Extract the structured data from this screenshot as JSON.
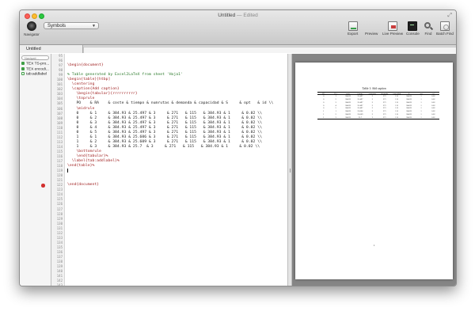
{
  "window": {
    "title": "Untitled",
    "title_suffix": " — Edited"
  },
  "toolbar": {
    "navigator_label": "Navigator",
    "symbols_value": "Symbols",
    "tools": [
      {
        "label": "Export",
        "icon": "export-icon"
      },
      {
        "label": "Preview",
        "icon": "preview-icon"
      },
      {
        "label": "Live Preview",
        "icon": "live-preview-icon"
      },
      {
        "label": "Console",
        "icon": "console-icon"
      },
      {
        "label": "Find",
        "icon": "find-icon"
      },
      {
        "label": "Batch Find",
        "icon": "batch-find-icon"
      }
    ]
  },
  "tabs": [
    {
      "label": "Untitled"
    }
  ],
  "sidebar": {
    "search_placeholder": "Navigati...",
    "items": [
      {
        "label": "TEX TS-pro..."
      },
      {
        "label": "TEX encodi..."
      },
      {
        "label": "tab:addlabel"
      }
    ]
  },
  "editor": {
    "lines": [
      {
        "n": "95",
        "text": "",
        "kind": ""
      },
      {
        "n": "96",
        "text": "",
        "kind": ""
      },
      {
        "n": "97",
        "text": "\\begin{document}",
        "kind": "cmd"
      },
      {
        "n": "98",
        "text": "",
        "kind": ""
      },
      {
        "n": "99",
        "text": "% Table generated by Excel2LaTeX from sheet 'Hoja1'",
        "kind": "comment"
      },
      {
        "n": "100",
        "text": "\\begin{table}[htbp]",
        "kind": "cmd"
      },
      {
        "n": "101",
        "text": "  \\centering",
        "kind": "cmd"
      },
      {
        "n": "102",
        "text": "  \\caption{Add caption}",
        "kind": "cmd"
      },
      {
        "n": "103",
        "text": "    \\begin{tabular}{rrrrrrrrrr}",
        "kind": "cmd"
      },
      {
        "n": "104",
        "text": "    \\toprule",
        "kind": "cmd"
      },
      {
        "n": "105",
        "text": "    PO    & RA    & coste & tiempo & numrutas & demanda & capacidad & S     & opt   & id \\\\",
        "kind": ""
      },
      {
        "n": "106",
        "text": "    \\midrule",
        "kind": "cmd"
      },
      {
        "n": "107",
        "text": "    0     & 1     & 384.93 & 25.497 & 3     & 271   & 115   & 384.93 & 1     & 0.02 \\\\",
        "kind": ""
      },
      {
        "n": "108",
        "text": "    0     & 2     & 384.93 & 25.497 & 3     & 271   & 115   & 384.93 & 1     & 0.02 \\\\",
        "kind": ""
      },
      {
        "n": "109",
        "text": "    0     & 3     & 384.93 & 25.497 & 3     & 271   & 115   & 384.93 & 1     & 0.02 \\\\",
        "kind": ""
      },
      {
        "n": "110",
        "text": "    0     & 4     & 384.93 & 25.497 & 3     & 271   & 115   & 384.93 & 1     & 0.02 \\\\",
        "kind": ""
      },
      {
        "n": "111",
        "text": "    0     & 5     & 384.93 & 25.497 & 3     & 271   & 115   & 384.93 & 1     & 0.02 \\\\",
        "kind": ""
      },
      {
        "n": "112",
        "text": "    1     & 1     & 384.93 & 25.606 & 3     & 271   & 115   & 384.93 & 1     & 0.02 \\\\",
        "kind": ""
      },
      {
        "n": "113",
        "text": "    1     & 2     & 384.93 & 25.609 & 3     & 271   & 115   & 384.93 & 1     & 0.02 \\\\",
        "kind": ""
      },
      {
        "n": "114",
        "text": "    1     & 3     & 384.93 & 25.7  & 3     & 271   & 115   & 384.93 & 1     & 0.02 \\\\",
        "kind": ""
      },
      {
        "n": "115",
        "text": "    \\bottomrule",
        "kind": "cmd"
      },
      {
        "n": "116",
        "text": "    \\end{tabular}%",
        "kind": "cmd"
      },
      {
        "n": "117",
        "text": "  \\label{tab:addlabel}%",
        "kind": "cmd"
      },
      {
        "n": "118",
        "text": "\\end{table}%",
        "kind": "cmd"
      },
      {
        "n": "119",
        "text": "",
        "kind": "cursor"
      },
      {
        "n": "120",
        "text": "",
        "kind": ""
      },
      {
        "n": "121",
        "text": "",
        "kind": ""
      },
      {
        "n": "122",
        "text": "\\end{document}",
        "kind": "cmd",
        "error": true
      },
      {
        "n": "123",
        "text": "",
        "kind": ""
      },
      {
        "n": "124",
        "text": "",
        "kind": ""
      },
      {
        "n": "125",
        "text": "",
        "kind": ""
      },
      {
        "n": "126",
        "text": "",
        "kind": ""
      },
      {
        "n": "127",
        "text": "",
        "kind": ""
      },
      {
        "n": "128",
        "text": "",
        "kind": ""
      },
      {
        "n": "129",
        "text": "",
        "kind": ""
      },
      {
        "n": "130",
        "text": "",
        "kind": ""
      },
      {
        "n": "131",
        "text": "",
        "kind": ""
      },
      {
        "n": "132",
        "text": "",
        "kind": ""
      },
      {
        "n": "133",
        "text": "",
        "kind": ""
      },
      {
        "n": "134",
        "text": "",
        "kind": ""
      },
      {
        "n": "135",
        "text": "",
        "kind": ""
      },
      {
        "n": "136",
        "text": "",
        "kind": ""
      },
      {
        "n": "137",
        "text": "",
        "kind": ""
      },
      {
        "n": "138",
        "text": "",
        "kind": ""
      },
      {
        "n": "139",
        "text": "",
        "kind": ""
      },
      {
        "n": "140",
        "text": "",
        "kind": ""
      },
      {
        "n": "141",
        "text": "",
        "kind": ""
      },
      {
        "n": "142",
        "text": "",
        "kind": ""
      },
      {
        "n": "143",
        "text": "",
        "kind": ""
      }
    ]
  },
  "preview": {
    "caption": "Table 1: Add caption",
    "headers": [
      "PO",
      "RA",
      "coste",
      "tiempo",
      "numrutas",
      "demanda",
      "capacidad",
      "S",
      "opt",
      "id"
    ],
    "rows": [
      [
        "0",
        "1",
        "384.93",
        "25.497",
        "3",
        "271",
        "115",
        "384.93",
        "1",
        "0.02"
      ],
      [
        "0",
        "2",
        "384.93",
        "25.497",
        "3",
        "271",
        "115",
        "384.93",
        "1",
        "0.02"
      ],
      [
        "0",
        "3",
        "384.93",
        "25.497",
        "3",
        "271",
        "115",
        "384.93",
        "1",
        "0.02"
      ],
      [
        "0",
        "4",
        "384.93",
        "25.497",
        "3",
        "271",
        "115",
        "384.93",
        "1",
        "0.02"
      ],
      [
        "0",
        "5",
        "384.93",
        "25.497",
        "3",
        "271",
        "115",
        "384.93",
        "1",
        "0.02"
      ],
      [
        "1",
        "1",
        "384.93",
        "25.606",
        "3",
        "271",
        "115",
        "384.93",
        "1",
        "0.02"
      ],
      [
        "1",
        "2",
        "384.93",
        "25.609",
        "3",
        "271",
        "115",
        "384.93",
        "1",
        "0.02"
      ],
      [
        "1",
        "3",
        "384.93",
        "25.7",
        "3",
        "271",
        "115",
        "384.93",
        "1",
        "0.02"
      ]
    ],
    "page_number": "1"
  }
}
